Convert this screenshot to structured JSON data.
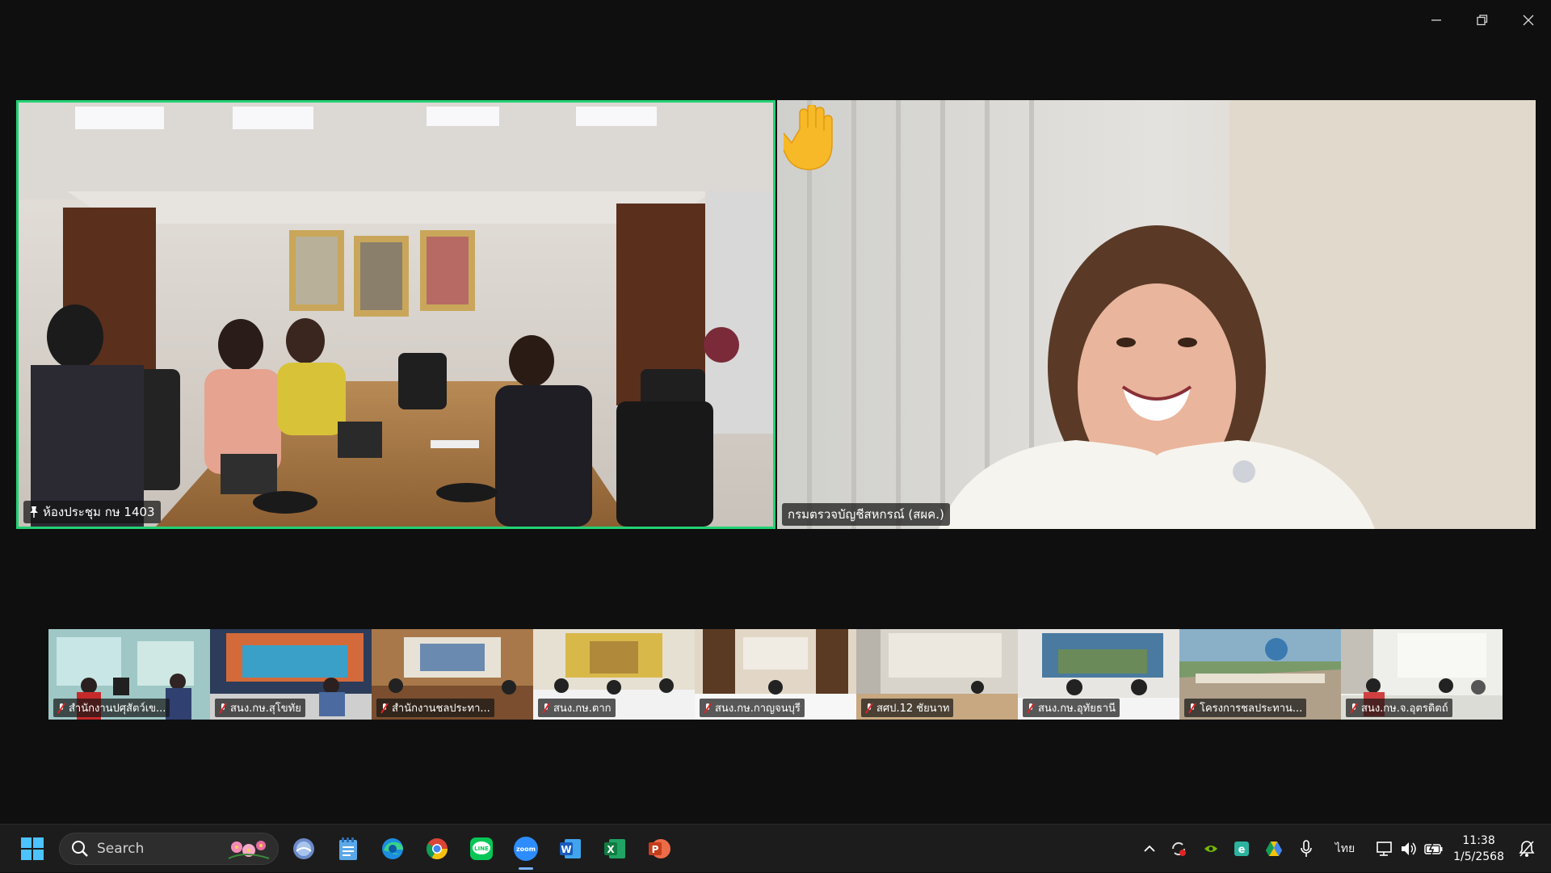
{
  "window": {
    "controls": [
      "minimize",
      "restore",
      "close"
    ]
  },
  "main_tiles": {
    "left": {
      "name": "ห้องประชุม กษ 1403",
      "pinned": true,
      "active_speaker": true,
      "border_color": "#22d273"
    },
    "right": {
      "name": "กรมตรวจบัญชีสหกรณ์ (สผค.)",
      "raised_hand": true
    }
  },
  "thumbnails": [
    {
      "name": "สำนักงานปศุสัตว์เข...",
      "muted": true
    },
    {
      "name": "สนง.กษ.สุโขทัย",
      "muted": true
    },
    {
      "name": "สำนักงานชลประทา...",
      "muted": true
    },
    {
      "name": "สนง.กษ.ตาก",
      "muted": true
    },
    {
      "name": "สนง.กษ.กาญจนบุรี",
      "muted": true
    },
    {
      "name": "สศป.12 ชัยนาท",
      "muted": true
    },
    {
      "name": "สนง.กษ.อุทัยธานี",
      "muted": true
    },
    {
      "name": "โครงการชลประทาน...",
      "muted": true
    },
    {
      "name": "สนง.กษ.จ.อุตรดิตถ์",
      "muted": true
    }
  ],
  "taskbar": {
    "search_placeholder": "Search",
    "apps": [
      "widgets-icon",
      "notepad-icon",
      "edge-icon",
      "chrome-icon",
      "line-icon",
      "zoom-icon",
      "word-icon",
      "excel-icon",
      "powerpoint-icon"
    ],
    "active_app": "zoom-icon",
    "zoom_label": "zoom",
    "word_label": "W",
    "excel_label": "X",
    "powerpoint_label": "P",
    "line_label": "LINE",
    "language": "ไทย",
    "time": "11:38",
    "date": "1/5/2568"
  }
}
